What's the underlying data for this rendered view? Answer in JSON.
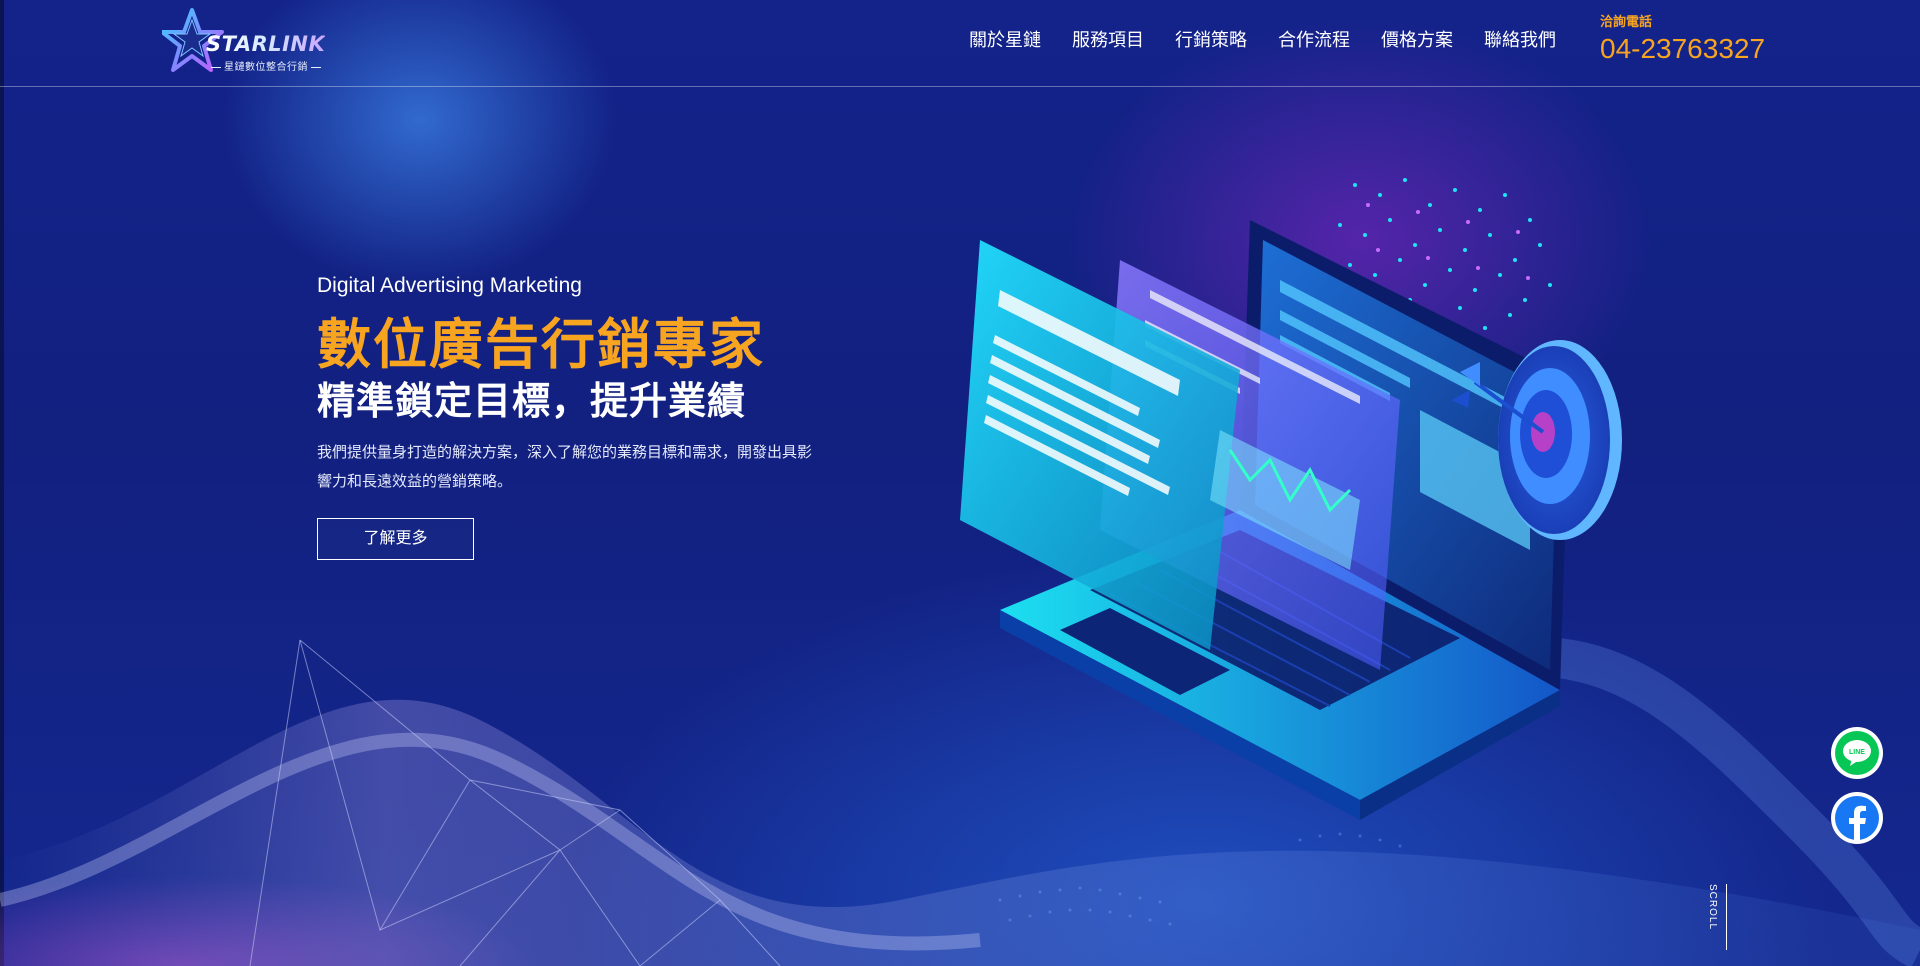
{
  "header": {
    "logo_word": "STARLINK",
    "logo_subtitle": "星鏈數位整合行銷",
    "nav": [
      "關於星鏈",
      "服務項目",
      "行銷策略",
      "合作流程",
      "價格方案",
      "聯絡我們"
    ],
    "phone_label": "洽詢電話",
    "phone_number": "04-23763327"
  },
  "hero": {
    "eyebrow": "Digital Advertising Marketing",
    "title": "數位廣告行銷專家",
    "subtitle": "精準鎖定目標，提升業績",
    "description": "我們提供量身打造的解決方案，深入了解您的業務目標和需求，開發出具影響力和長遠效益的營銷策略。",
    "button_label": "了解更多"
  },
  "social": {
    "line_icon": "line-icon",
    "line_label": "LINE",
    "facebook_icon": "facebook-icon"
  },
  "scroll_label": "SCROLL",
  "colors": {
    "accent": "#f7a421",
    "background": "#13238a",
    "line_green": "#06c755",
    "facebook_blue": "#1877f2"
  }
}
